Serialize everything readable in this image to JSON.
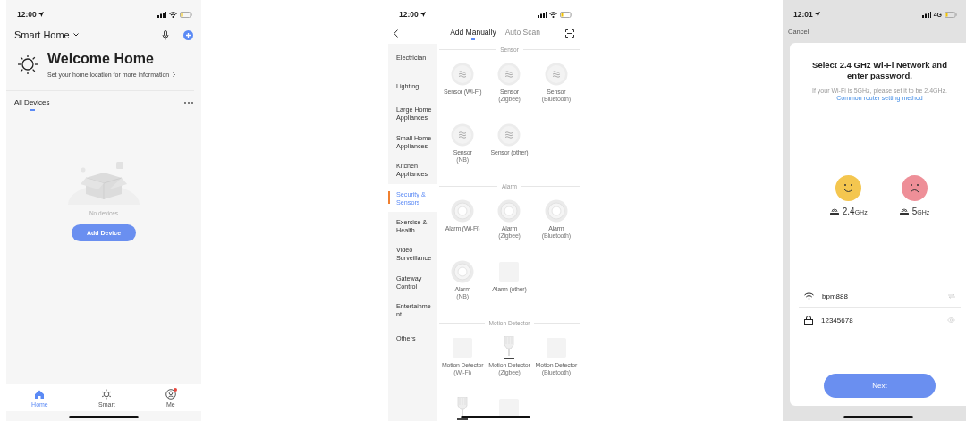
{
  "home_screen": {
    "status_time": "12:00",
    "home_title": "Smart Home",
    "welcome_title": "Welcome Home",
    "welcome_subtitle": "Set your home location for more information",
    "device_tabs": [
      {
        "label": "All Devices",
        "selected": true
      }
    ],
    "empty_text": "No devices",
    "add_button": "Add Device",
    "tab_bar": [
      {
        "label": "Home",
        "selected": true,
        "badge": false
      },
      {
        "label": "Smart",
        "selected": false,
        "badge": false
      },
      {
        "label": "Me",
        "selected": false,
        "badge": true
      }
    ]
  },
  "add_device_screen": {
    "status_time": "12:00",
    "tabs": [
      {
        "label": "Add Manually",
        "selected": true
      },
      {
        "label": "Auto Scan",
        "selected": false
      }
    ],
    "categories": [
      {
        "label": "Electrician",
        "selected": false
      },
      {
        "label": "Lighting",
        "selected": false
      },
      {
        "label": "Large Home Appliances",
        "selected": false
      },
      {
        "label": "Small Home Appliances",
        "selected": false
      },
      {
        "label": "Kitchen Appliances",
        "selected": false
      },
      {
        "label": "Security & Sensors",
        "selected": true
      },
      {
        "label": "Exercise & Health",
        "selected": false
      },
      {
        "label": "Video Surveillance",
        "selected": false
      },
      {
        "label": "Gateway Control",
        "selected": false
      },
      {
        "label": "Entertainme nt",
        "selected": false
      },
      {
        "label": "Others",
        "selected": false
      }
    ],
    "sections": [
      {
        "title": "Sensor",
        "devices": [
          {
            "kind": "sensor",
            "name": "Sensor (Wi-Fi)"
          },
          {
            "kind": "sensor",
            "name": "Sensor",
            "variant": "(Zigbee)"
          },
          {
            "kind": "sensor",
            "name": "Sensor",
            "variant": "(Bluetooth)"
          },
          {
            "kind": "sensor",
            "name": "Sensor",
            "variant": "(NB)"
          },
          {
            "kind": "sensor",
            "name": "Sensor (other)"
          }
        ]
      },
      {
        "title": "Alarm",
        "devices": [
          {
            "kind": "alarm",
            "name": "Alarm (Wi-Fi)"
          },
          {
            "kind": "alarm",
            "name": "Alarm",
            "variant": "(Zigbee)"
          },
          {
            "kind": "alarm",
            "name": "Alarm",
            "variant": "(Bluetooth)"
          },
          {
            "kind": "alarm",
            "name": "Alarm",
            "variant": "(NB)"
          },
          {
            "kind": "blank",
            "name": "Alarm (other)"
          }
        ]
      },
      {
        "title": "Motion Detector",
        "devices": [
          {
            "kind": "blank",
            "name": "Motion Detector",
            "variant": "(Wi-Fi)"
          },
          {
            "kind": "motion",
            "name": "Motion Detector",
            "variant": "(Zigbee)"
          },
          {
            "kind": "blank",
            "name": "Motion Detector",
            "variant": "(Bluetooth)"
          },
          {
            "kind": "motion"
          },
          {
            "kind": "blank"
          }
        ]
      }
    ]
  },
  "wifi_screen": {
    "status_time": "12:01",
    "network": "4G",
    "cancel": "Cancel",
    "title": "Select 2.4 GHz Wi-Fi Network and enter password.",
    "hint": "If your Wi-Fi is 5GHz, please set it to be 2.4GHz.",
    "link": "Common router setting method",
    "bands": [
      {
        "kind": "good",
        "value": "2.4",
        "unit": "GHz"
      },
      {
        "kind": "bad",
        "value": "5",
        "unit": "GHz"
      }
    ],
    "wifi_name": "bpm888",
    "password": "12345678",
    "next_button": "Next"
  }
}
